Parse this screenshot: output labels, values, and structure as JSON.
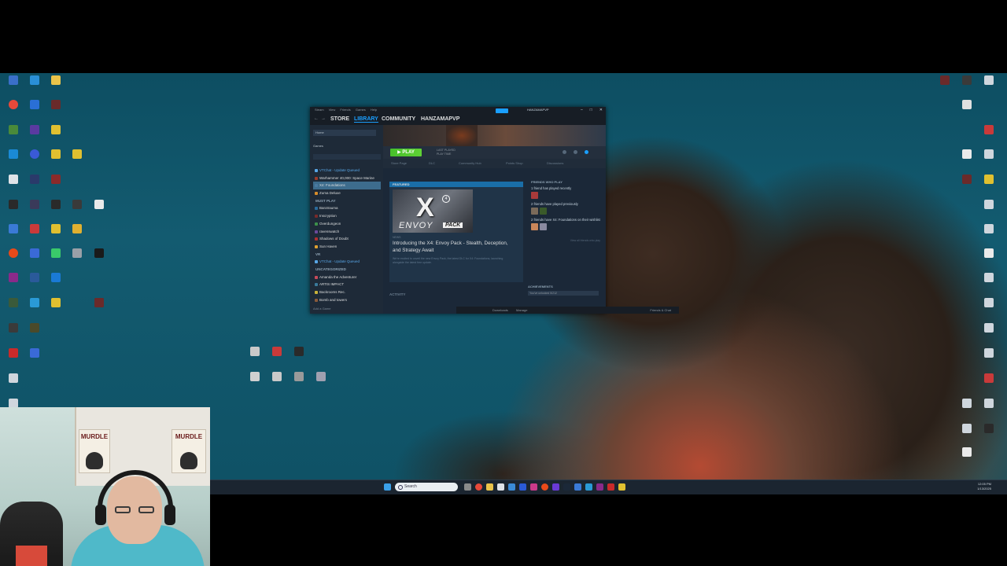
{
  "steam": {
    "menu": [
      "Steam",
      "View",
      "Friends",
      "Games",
      "Help"
    ],
    "nav": {
      "store": "STORE",
      "library": "LIBRARY",
      "community": "COMMUNITY",
      "user": "HANZAMAPVP"
    },
    "sidebar": {
      "home": "Home",
      "games_filter": "Games",
      "add_game": "Add a Game",
      "items": [
        {
          "label": "VTChat - Update Queued",
          "type": "update",
          "color": "#58a6e6"
        },
        {
          "label": "Warhammer 40,000: Space Marine",
          "type": "game",
          "color": "#9b3b2b"
        },
        {
          "label": "X4: Foundations",
          "type": "selected",
          "color": "#4a7aa0"
        },
        {
          "label": "Zuma Deluxe",
          "type": "game",
          "color": "#d68c2a"
        },
        {
          "label": "MUST PLAY",
          "type": "category",
          "color": ""
        },
        {
          "label": "Barotrauma",
          "type": "game",
          "color": "#2a6a9b"
        },
        {
          "label": "Inscryption",
          "type": "game",
          "color": "#7a2a2a"
        },
        {
          "label": "Overdungeon",
          "type": "game",
          "color": "#3c8f4a"
        },
        {
          "label": "ravenswatch",
          "type": "game",
          "color": "#6a4a9b"
        },
        {
          "label": "Shadows of Doubt",
          "type": "game",
          "color": "#b03030"
        },
        {
          "label": "Sun Haven",
          "type": "game",
          "color": "#e0a030"
        },
        {
          "label": "VR",
          "type": "category",
          "color": ""
        },
        {
          "label": "VTChat - Update Queued",
          "type": "update",
          "color": "#58a6e6"
        },
        {
          "label": "UNCATEGORIZED",
          "type": "category",
          "color": ""
        },
        {
          "label": "Amanda the Adventurer",
          "type": "game",
          "color": "#c94a5a"
        },
        {
          "label": "ARTIS IMPACT",
          "type": "game",
          "color": "#3a7a9b"
        },
        {
          "label": "Backrooms Rec.",
          "type": "game",
          "color": "#c9b23a"
        },
        {
          "label": "Bomb and towers",
          "type": "game",
          "color": "#8a5a3a"
        }
      ]
    },
    "play": {
      "label": "PLAY",
      "meta1": "LAST PLAYED",
      "meta2": "PLAY TIME"
    },
    "subtabs": [
      "Store Page",
      "DLC",
      "Community Hub",
      "Points Shop",
      "Discussions"
    ],
    "featured": {
      "header": "FEATURED",
      "art_title": "X",
      "art_badge": "4",
      "art_envoy": "ENVOY",
      "art_pack": "PACK",
      "caption": "NEWS",
      "title": "Introducing the X4: Envoy Pack - Stealth, Deception, and Strategy Await",
      "description": "We're excited to unveil the new Envoy Pack, the latest DLC for X4: Foundations, launching alongside the latest free update."
    },
    "friends": {
      "header": "FRIENDS WHO PLAY",
      "line1": "1 friend has played recently",
      "line2": "2 friends have played previously",
      "line3": "2 friends have X4: Foundations on their wishlist",
      "link": "View all friends who play"
    },
    "activity": "ACTIVITY",
    "achievements": {
      "header": "ACHIEVEMENTS",
      "bar": "You've unlocked 5/212"
    },
    "footer": {
      "downloads": "Downloads",
      "manage": "Manage",
      "friends": "Friends & Chat"
    }
  },
  "taskbar": {
    "search_placeholder": "Search",
    "time": "12:05 PM",
    "date": "1/13/2025"
  },
  "webcam": {
    "poster_left": "MURDLE",
    "poster_right": "MURDLE"
  }
}
